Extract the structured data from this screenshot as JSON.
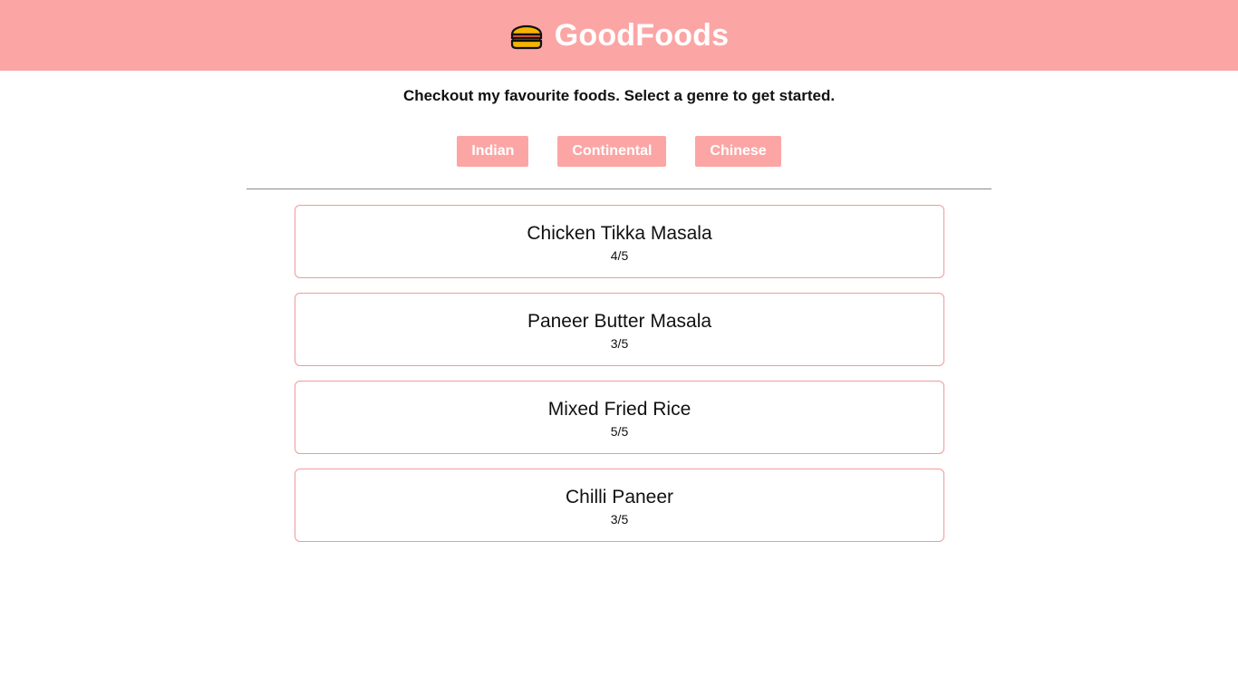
{
  "brand": {
    "title": "GoodFoods",
    "icon": "burger-icon",
    "header_color": "#fca5a5"
  },
  "tagline": "Checkout my favourite foods. Select a genre to get started.",
  "genres": [
    {
      "label": "Indian"
    },
    {
      "label": "Continental"
    },
    {
      "label": "Chinese"
    }
  ],
  "foods": [
    {
      "name": "Chicken Tikka Masala",
      "rating": "4/5"
    },
    {
      "name": "Paneer Butter Masala",
      "rating": "3/5"
    },
    {
      "name": "Mixed Fried Rice",
      "rating": "5/5"
    },
    {
      "name": "Chilli Paneer",
      "rating": "3/5"
    }
  ]
}
